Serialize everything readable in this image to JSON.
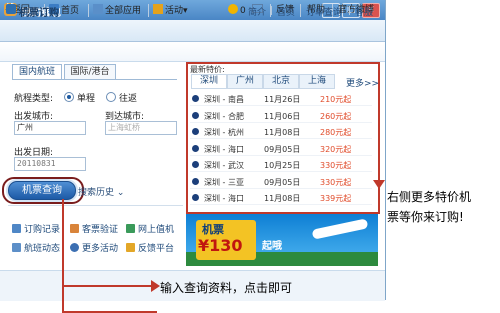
{
  "window": {
    "title": "我的钱包",
    "logo_glyph": "钱"
  },
  "toolbar": {
    "back": "返回",
    "home": "首页",
    "apps": "全部应用",
    "activity": "活动",
    "coins": "0",
    "feedback": "反馈",
    "help": "帮助",
    "weibo": "官方微博"
  },
  "app": {
    "title": "机票订购",
    "links": [
      "简介",
      "首页",
      "订单查询",
      "客服"
    ]
  },
  "search_form": {
    "tabs": [
      "国内航班",
      "国际/港台"
    ],
    "trip_type_label": "航程类型:",
    "one_way": "单程",
    "round_trip": "往返",
    "from_label": "出发城市:",
    "from_value": "广州",
    "to_label": "到达城市:",
    "to_placeholder": "上海虹桥",
    "date_label": "出发日期:",
    "date_value": "20110831",
    "search_button": "机票查询",
    "history_link": "搜索历史"
  },
  "quick_links": [
    [
      "订购记录",
      "客票验证",
      "网上值机"
    ],
    [
      "航班动态",
      "更多活动",
      "反馈平台"
    ]
  ],
  "specials": {
    "title": "最新特价:",
    "cities": [
      "深圳",
      "广州",
      "北京",
      "上海"
    ],
    "more": "更多>>",
    "rows": [
      {
        "route": "深圳 - 南昌",
        "date": "11月26日",
        "price": "210元起"
      },
      {
        "route": "深圳 - 合肥",
        "date": "11月06日",
        "price": "260元起"
      },
      {
        "route": "深圳 - 杭州",
        "date": "11月08日",
        "price": "280元起"
      },
      {
        "route": "深圳 - 海口",
        "date": "09月05日",
        "price": "320元起"
      },
      {
        "route": "深圳 - 武汉",
        "date": "10月25日",
        "price": "330元起"
      },
      {
        "route": "深圳 - 三亚",
        "date": "09月05日",
        "price": "330元起"
      },
      {
        "route": "深圳 - 海口",
        "date": "11月08日",
        "price": "339元起"
      }
    ]
  },
  "ad": {
    "label": "机票",
    "price": "¥130",
    "slogan": "起哦"
  },
  "annotations": {
    "right_line1": "右侧更多特价机",
    "right_line2": "票等你来订购!",
    "bottom": "输入查询资料，点击即可"
  },
  "colors": {
    "highlight_red": "#c0392b",
    "price_red": "#e04b2a",
    "brand_blue": "#1d5aa6"
  }
}
